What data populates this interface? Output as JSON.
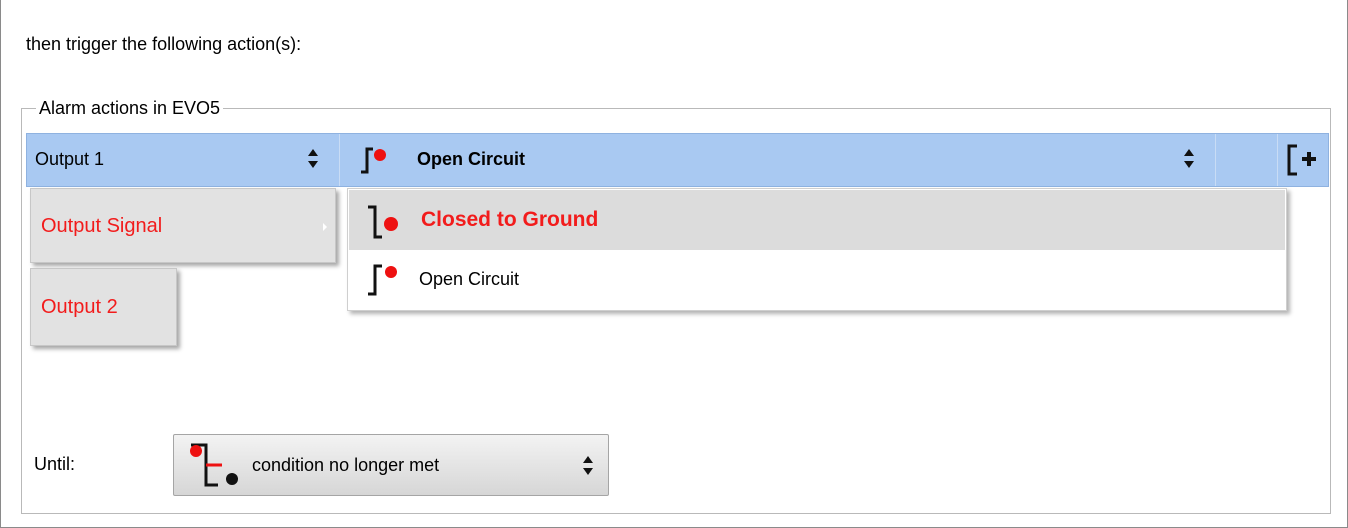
{
  "intro_text": "then trigger the following action(s):",
  "group": {
    "legend": "Alarm actions in EVO5"
  },
  "action_row": {
    "output_value": "Output 1",
    "state_value": "Open Circuit",
    "add_icon": "add-bracket-icon"
  },
  "output_menu": {
    "items": [
      {
        "label": "Output Signal",
        "has_submenu": true
      },
      {
        "label": "Output 2",
        "has_submenu": false
      }
    ]
  },
  "state_dropdown": {
    "items": [
      {
        "label": "Closed to Ground",
        "icon": "closed-to-ground-icon",
        "selected": true
      },
      {
        "label": "Open Circuit",
        "icon": "open-circuit-icon",
        "selected": false
      }
    ]
  },
  "until": {
    "label": "Until:",
    "value": "condition no longer met",
    "icon": "condition-reset-icon"
  },
  "colors": {
    "row_highlight": "#a9c9f2",
    "accent_red": "#f21c1c",
    "menu_bg": "#e2e2e2"
  }
}
